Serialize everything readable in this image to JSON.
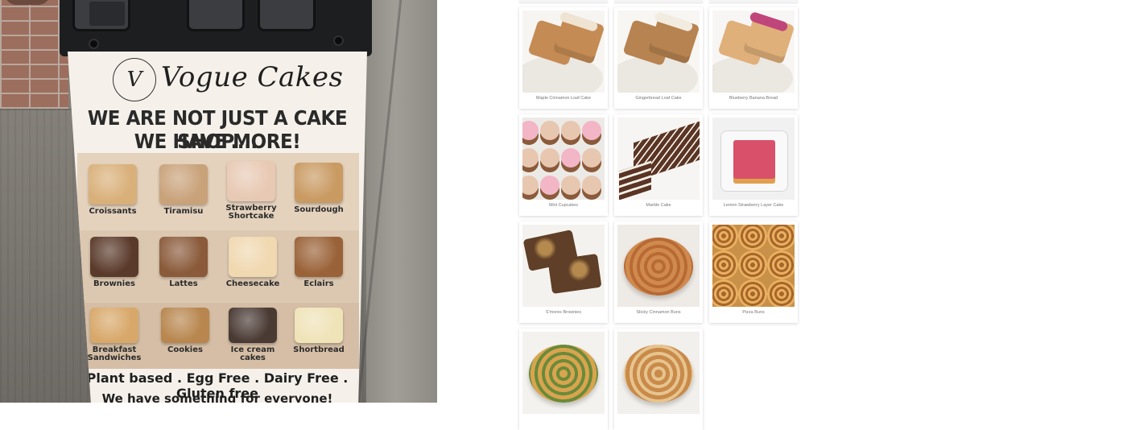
{
  "sign": {
    "logo_monogram": "V",
    "logo_text": "Vogue Cakes",
    "headline_line1": "WE ARE NOT JUST A CAKE SHOP....",
    "headline_line2": "WE HAVE MORE!",
    "menu_items": [
      {
        "label": "Croissants",
        "color": "#d9b07a"
      },
      {
        "label": "Tiramisu",
        "color": "#c9a27a"
      },
      {
        "label": "Strawberry\nShortcake",
        "color": "#e8c9b4"
      },
      {
        "label": "Sourdough",
        "color": "#c99a62"
      },
      {
        "label": "Brownies",
        "color": "#5a3a2a"
      },
      {
        "label": "Lattes",
        "color": "#8a5a3a"
      },
      {
        "label": "Cheesecake",
        "color": "#f0d8b0"
      },
      {
        "label": "Eclairs",
        "color": "#9a6238"
      },
      {
        "label": "Breakfast\nSandwiches",
        "color": "#d8a86a"
      },
      {
        "label": "Cookies",
        "color": "#b8864e"
      },
      {
        "label": "Ice cream\ncakes",
        "color": "#4a3a34"
      },
      {
        "label": "Shortbread",
        "color": "#efe3b8"
      }
    ],
    "footer_line1": "Plant based . Egg Free . Dairy Free . Gluten free",
    "footer_line2": "We have something for everyone!"
  },
  "products": [
    {
      "name": "Maple Cinnamon Loaf Cake",
      "bg": "#f7f5f2",
      "food": "#c58b54",
      "accent": "#efe3d2"
    },
    {
      "name": "Gingerbread Loaf Cake",
      "bg": "#f7f6f3",
      "food": "#b78350",
      "accent": "#f2ebe0"
    },
    {
      "name": "Blueberry Banana Bread",
      "bg": "#f8f6f4",
      "food": "#e0b07a",
      "accent": "#c0457a"
    },
    {
      "name": "Mini Cupcakes",
      "bg": "#eceae6",
      "food": "#8a5a3a",
      "accent": "#e8c7b0"
    },
    {
      "name": "Marble Cake",
      "bg": "#f6f5f3",
      "food": "#5a3424",
      "accent": "#f5efe6"
    },
    {
      "name": "Lemon Strawberry Layer Cake",
      "bg": "#f1f1f1",
      "food": "#e0a050",
      "accent": "#d9506a"
    },
    {
      "name": "S'mores Brownies",
      "bg": "#f4f2ef",
      "food": "#5f3f27",
      "accent": "#b58a4e"
    },
    {
      "name": "Sticky Cinnamon Buns",
      "bg": "#eeeae6",
      "food": "#d08a4e",
      "accent": "#b86a34"
    },
    {
      "name": "Pizza Buns",
      "bg": "#c89048",
      "food": "#a8662a",
      "accent": "#e8b060"
    },
    {
      "name": "",
      "bg": "#f3f2ef",
      "food": "#d9a44e",
      "accent": "#6a8a3a"
    },
    {
      "name": "",
      "bg": "#f2f0ec",
      "food": "#c98a4a",
      "accent": "#e6c48e"
    }
  ]
}
